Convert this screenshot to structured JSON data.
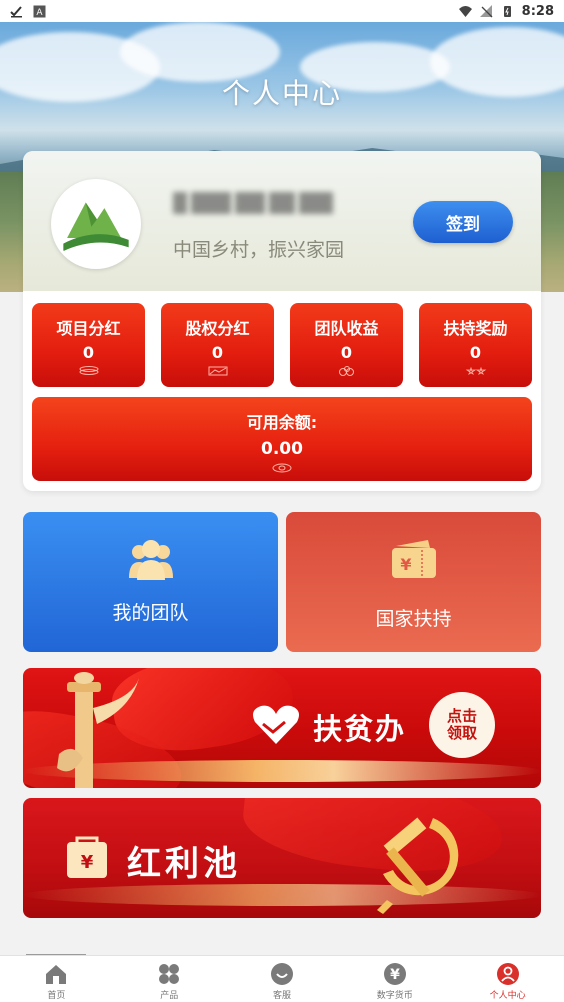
{
  "status_bar": {
    "time": "8:28"
  },
  "header": {
    "title": "个人中心"
  },
  "profile": {
    "slogan": "中国乡村，振兴家园",
    "checkin_label": "签到"
  },
  "stats": [
    {
      "label": "项目分红",
      "value": "0",
      "icon": "stack-icon"
    },
    {
      "label": "股权分红",
      "value": "0",
      "icon": "chart-icon"
    },
    {
      "label": "团队收益",
      "value": "0",
      "icon": "coins-icon"
    },
    {
      "label": "扶持奖励",
      "value": "0",
      "icon": "stars-icon"
    }
  ],
  "balance": {
    "label": "可用余额:",
    "value": "0.00",
    "icon": "money-icon"
  },
  "tiles": {
    "team": {
      "label": "我的团队",
      "icon": "group-icon",
      "color": "#2f7ee6"
    },
    "support": {
      "label": "国家扶持",
      "icon": "ticket-icon",
      "color": "#e25a45"
    }
  },
  "banners": {
    "poverty": {
      "title": "扶贫办",
      "button": "点击领取"
    },
    "dividend": {
      "title": "红利池"
    }
  },
  "nav": [
    {
      "label": "首页",
      "icon": "home-icon",
      "active": false
    },
    {
      "label": "产品",
      "icon": "grid-icon",
      "active": false
    },
    {
      "label": "客服",
      "icon": "service-icon",
      "active": false
    },
    {
      "label": "数字货币",
      "icon": "yen-coin-icon",
      "active": false
    },
    {
      "label": "个人中心",
      "icon": "person-icon",
      "active": true
    }
  ],
  "colors": {
    "accent_red": "#e31d0f",
    "accent_blue": "#2166d6",
    "active_nav": "#d9302b"
  }
}
